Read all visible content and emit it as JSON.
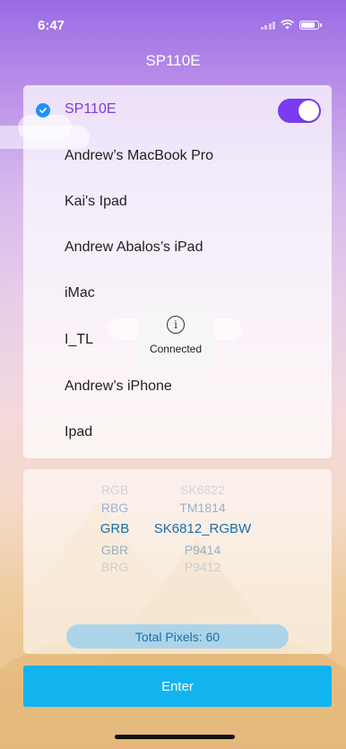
{
  "status_bar": {
    "time": "6:47"
  },
  "nav": {
    "title": "SP110E"
  },
  "devices": [
    {
      "name": "SP110E",
      "selected": true,
      "toggle_on": true
    },
    {
      "name": "Andrew’s MacBook Pro"
    },
    {
      "name": "Kai's Ipad"
    },
    {
      "name": "Andrew Abalos’s iPad"
    },
    {
      "name": "iMac"
    },
    {
      "name": "I_TL"
    },
    {
      "name": "Andrew’s iPhone"
    },
    {
      "name": "Ipad"
    }
  ],
  "toast": {
    "icon": "info-icon",
    "text": "Connected"
  },
  "picker": {
    "color_order": [
      "RGB",
      "RBG",
      "GRB",
      "GBR",
      "BRG"
    ],
    "chip_type": [
      "SK6822",
      "TM1814",
      "SK6812_RGBW",
      "P9414",
      "P9412"
    ],
    "selected_index": 2
  },
  "total_pixels_label": "Total Pixels: 60",
  "enter_label": "Enter",
  "colors": {
    "accent_purple": "#7b3cf0",
    "selected_text": "#7a3ddb",
    "check_blue": "#1e90ff",
    "enter_blue": "#12b4ef",
    "picker_selected": "#1a6ea8"
  }
}
